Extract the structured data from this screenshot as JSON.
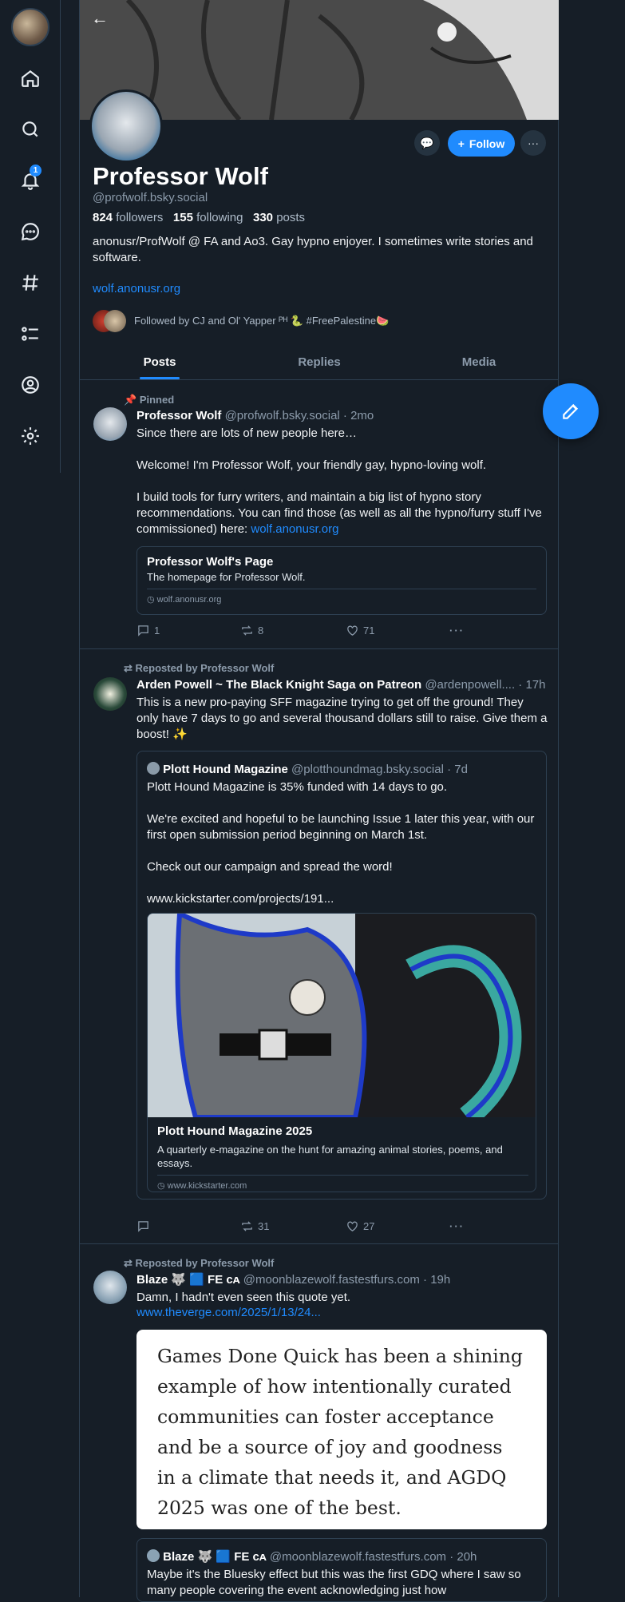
{
  "sidebar": {
    "notif_count": "1"
  },
  "profile": {
    "name": "Professor Wolf",
    "handle": "@profwolf.bsky.social",
    "followers_count": "824",
    "followers_label": "followers",
    "following_count": "155",
    "following_label": "following",
    "posts_count": "330",
    "posts_label": "posts",
    "bio": "anonusr/ProfWolf @ FA and Ao3. Gay hypno enjoyer. I sometimes write stories and software.",
    "website": "wolf.anonusr.org",
    "followed_by": "Followed by CJ and Ol' Yapper ᴾᴴ 🐍 #FreePalestine🍉",
    "follow_label": "Follow"
  },
  "tabs": [
    "Posts",
    "Replies",
    "Media"
  ],
  "posts": [
    {
      "pinned_label": "Pinned",
      "author_name": "Professor Wolf",
      "author_handle": "@profwolf.bsky.social · 2mo",
      "text": "Since there are lots of new people here…\n\nWelcome! I'm Professor Wolf, your friendly gay, hypno-loving wolf.\n\nI build tools for furry writers, and maintain a big list of hypno story recommendations. You can find those (as well as all the hypno/furry stuff I've commissioned) here: ",
      "link": "wolf.anonusr.org",
      "card": {
        "title": "Professor Wolf's Page",
        "desc": "The homepage for Professor Wolf.",
        "domain": "wolf.anonusr.org"
      },
      "replies": "1",
      "reposts": "8",
      "likes": "71"
    },
    {
      "repost_label": "Reposted by Professor Wolf",
      "author_name": "Arden Powell ~ The Black Knight Saga on Patreon",
      "author_handle": "@ardenpowell.... · 17h",
      "text": "This is a new pro-paying SFF magazine trying to get off the ground! They only have 7 days to go and several thousand dollars still to raise. Give them a boost! ✨",
      "quote": {
        "author_name": "Plott Hound Magazine",
        "author_handle": "@plotthoundmag.bsky.social · 7d",
        "text": "Plott Hound Magazine is 35% funded with 14 days to go.\n\nWe're excited and hopeful to be launching Issue 1 later this year, with our first open submission period beginning on March 1st.\n\nCheck out our campaign and spread the word!\n\nwww.kickstarter.com/projects/191...",
        "card_title": "Plott Hound Magazine 2025",
        "card_desc": "A quarterly e-magazine on the hunt for amazing animal stories, poems, and essays.",
        "card_domain": "www.kickstarter.com"
      },
      "replies": "",
      "reposts": "31",
      "likes": "27"
    },
    {
      "repost_label": "Reposted by Professor Wolf",
      "author_name": "Blaze 🐺 🟦 FE ᴄᴀ",
      "author_handle": "@moonblazewolf.fastestfurs.com · 19h",
      "text": "Damn, I hadn't even seen this quote yet.",
      "link": "www.theverge.com/2025/1/13/24...",
      "image_quote": "Games Done Quick has been a shining example of how intentionally curated communities can foster acceptance and be a source of joy and goodness in a climate that needs it, and AGDQ 2025 was one of the best.",
      "quote": {
        "author_name": "Blaze 🐺 🟦 FE ᴄᴀ",
        "author_handle": "@moonblazewolf.fastestfurs.com · 20h",
        "text": "Maybe it's the Bluesky effect but this was the first GDQ where I saw so many people covering the event acknowledging just how"
      }
    }
  ]
}
